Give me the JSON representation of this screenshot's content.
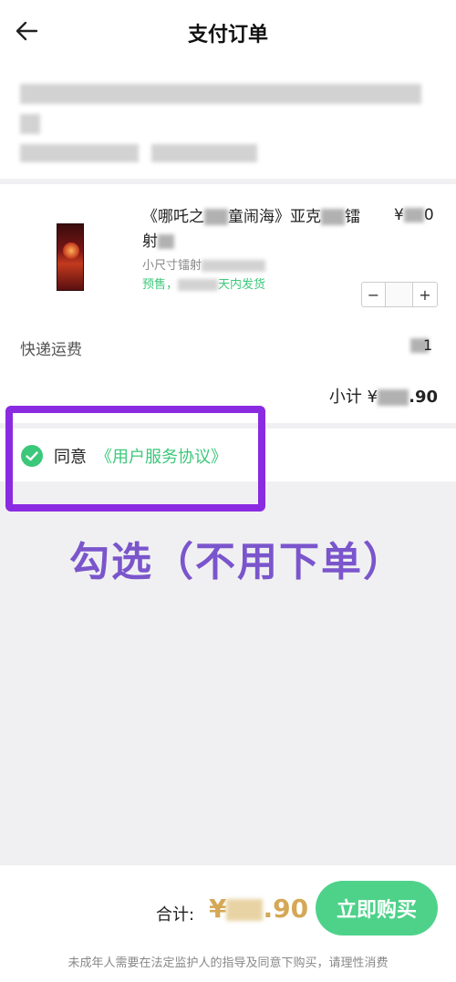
{
  "header": {
    "back_icon": "arrow-left-icon",
    "title": "支付订单"
  },
  "product": {
    "name_line1": "《哪吒之",
    "name_line1_mid": "童闹海》亚克",
    "name_line1_end": "镭",
    "name_line2": "射",
    "price_prefix": "¥",
    "price_suffix": "0",
    "spec_prefix": "小尺寸镭射",
    "presale_prefix": "预售，",
    "presale_suffix": "天内发货",
    "stepper": {
      "minus": "−",
      "plus": "+"
    },
    "shipping_label": "快递运费",
    "shipping_value": "1",
    "subtotal_label": "小计",
    "subtotal_value_prefix": "¥",
    "subtotal_value_suffix": ".90"
  },
  "agreement": {
    "check_icon": "check-circle-icon",
    "text": "同意",
    "link": "《用户服务协议》"
  },
  "annotation": {
    "text": "勾选（不用下单）",
    "color": "#7a55cc",
    "box_color": "#8a2be2"
  },
  "footer": {
    "total_label": "合计:",
    "total_value_prefix": "¥",
    "total_value_suffix": ".90",
    "buy_button": "立即购买",
    "notice": "未成年人需要在法定监护人的指导及同意下购买，请理性消费"
  },
  "colors": {
    "accent": "#3cc87a",
    "button": "#4ed28a",
    "total": "#d4a857"
  }
}
